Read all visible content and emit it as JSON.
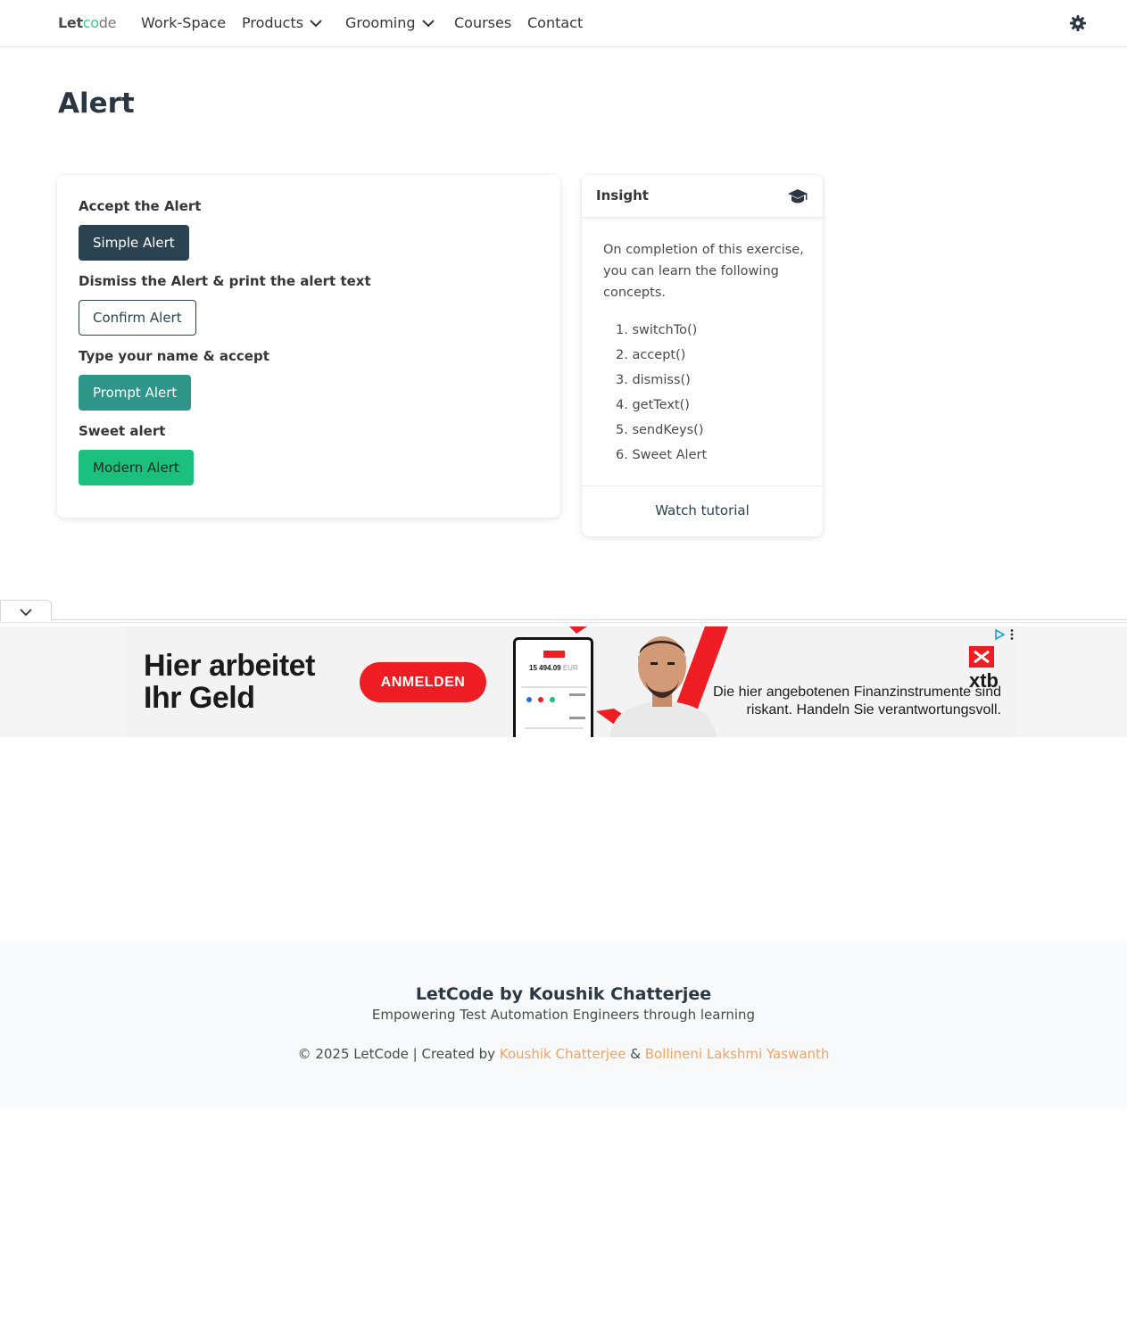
{
  "nav": {
    "logo_a": "Let",
    "logo_b": "co",
    "logo_c": "de",
    "items": [
      "Work-Space",
      "Products",
      "Grooming",
      "Courses",
      "Contact"
    ]
  },
  "page": {
    "title": "Alert"
  },
  "alerts": {
    "accept_label": "Accept the Alert",
    "simple_button": "Simple Alert",
    "dismiss_label": "Dismiss the Alert & print the alert text",
    "confirm_button": "Confirm Alert",
    "prompt_label": "Type your name & accept",
    "prompt_button": "Prompt Alert",
    "sweet_label": "Sweet alert",
    "modern_button": "Modern Alert"
  },
  "insight": {
    "title": "Insight",
    "description": "On completion of this exercise, you can learn the following concepts.",
    "concepts": [
      "1. switchTo()",
      "2. accept()",
      "3. dismiss()",
      "4. getText()",
      "5. sendKeys()",
      "6. Sweet Alert"
    ],
    "footer_link": "Watch tutorial"
  },
  "ad": {
    "headline_line1": "Hier arbeitet",
    "headline_line2": "Ihr Geld",
    "cta": "ANMELDEN",
    "brand": "xtb",
    "disclaimer_line1": "Die hier angebotenen Finanzinstrumente sind",
    "disclaimer_line2": "riskant. Handeln Sie verantwortungsvoll.",
    "phone_amount": "15 494.09",
    "phone_currency": "EUR"
  },
  "footer": {
    "title": "LetCode by Koushik Chatterjee",
    "subtitle": "Empowering Test Automation Engineers through learning",
    "copy_prefix": "© 2025 LetCode | Created by ",
    "author1": "Koushik Chatterjee",
    "amp": " & ",
    "author2": "Bollineni Lakshmi Yaswanth"
  },
  "colors": {
    "dark_button": "#2b4350",
    "teal_button": "#2e9688",
    "green_button": "#1cc07e",
    "footer_link": "#f0a366",
    "ad_red": "#ee1d23"
  }
}
